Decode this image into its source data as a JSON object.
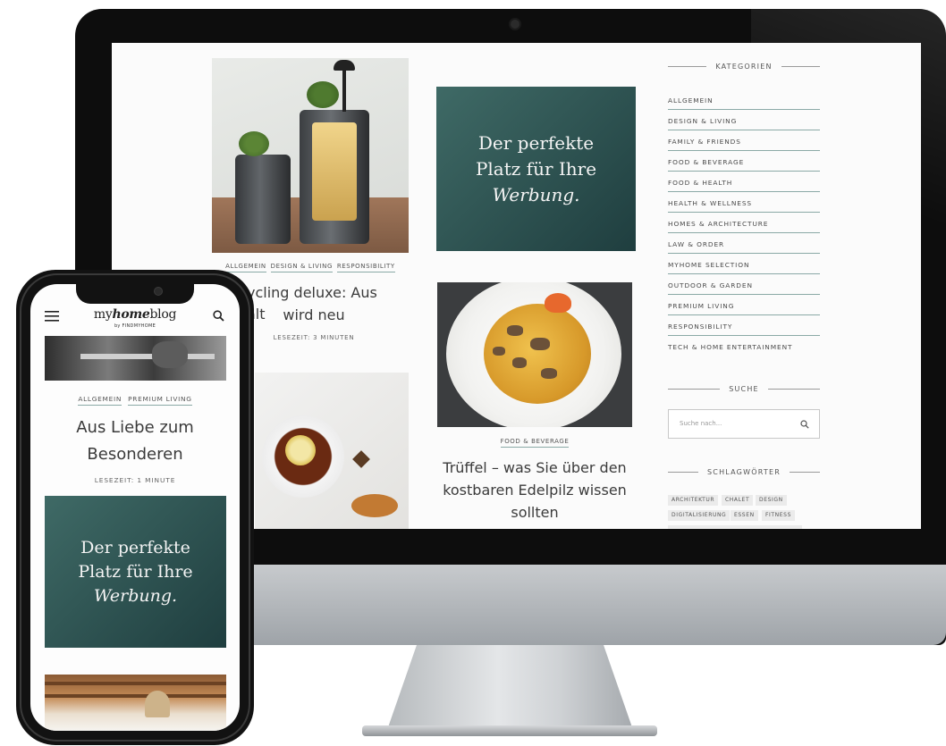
{
  "desktop": {
    "article1": {
      "tags": [
        "ALLGEMEIN",
        "DESIGN & LIVING",
        "RESPONSIBILITY"
      ],
      "title_line1": "ycling deluxe: Aus alt",
      "title_line2": "wird neu",
      "meta": "LESEZEIT: 3 MINUTEN"
    },
    "ad": {
      "line1": "Der perfekte",
      "line2": "Platz für Ihre",
      "line3": "Werbung."
    },
    "article2": {
      "tags": [
        "FOOD & BEVERAGE"
      ],
      "title_line1": "Trüffel – was Sie über den",
      "title_line2": "kostbaren Edelpilz wissen",
      "title_line3": "sollten"
    },
    "sidebar": {
      "categories_heading": "KATEGORIEN",
      "categories": [
        "ALLGEMEIN",
        "DESIGN & LIVING",
        "FAMILY & FRIENDS",
        "FOOD & BEVERAGE",
        "FOOD & HEALTH",
        "HEALTH & WELLNESS",
        "HOMES & ARCHITECTURE",
        "LAW & ORDER",
        "MYHOME SELECTION",
        "OUTDOOR & GARDEN",
        "PREMIUM LIVING",
        "RESPONSIBILITY",
        "TECH & HOME ENTERTAINMENT"
      ],
      "search_heading": "SUCHE",
      "search_placeholder": "Suche nach...",
      "tags_heading": "SCHLAGWÖRTER",
      "tags": [
        "ARCHITEKTUR",
        "CHALET",
        "DESIGN",
        "DIGITALISIERUNG",
        "ESSEN",
        "FITNESS"
      ]
    }
  },
  "mobile": {
    "logo_my": "my",
    "logo_home": "home",
    "logo_blog": "blog",
    "logo_sub": "by FINDMYHOME",
    "article": {
      "tags": [
        "ALLGEMEIN",
        "PREMIUM LIVING"
      ],
      "title_line1": "Aus Liebe zum",
      "title_line2": "Besonderen",
      "meta": "LESEZEIT: 1 MINUTE"
    },
    "ad": {
      "line1": "Der perfekte",
      "line2": "Platz für Ihre",
      "line3": "Werbung."
    }
  },
  "colors": {
    "ad_gradient_start": "#3f6a66",
    "ad_gradient_end": "#1f3e3f",
    "tag_underline": "#8aa9a6"
  }
}
